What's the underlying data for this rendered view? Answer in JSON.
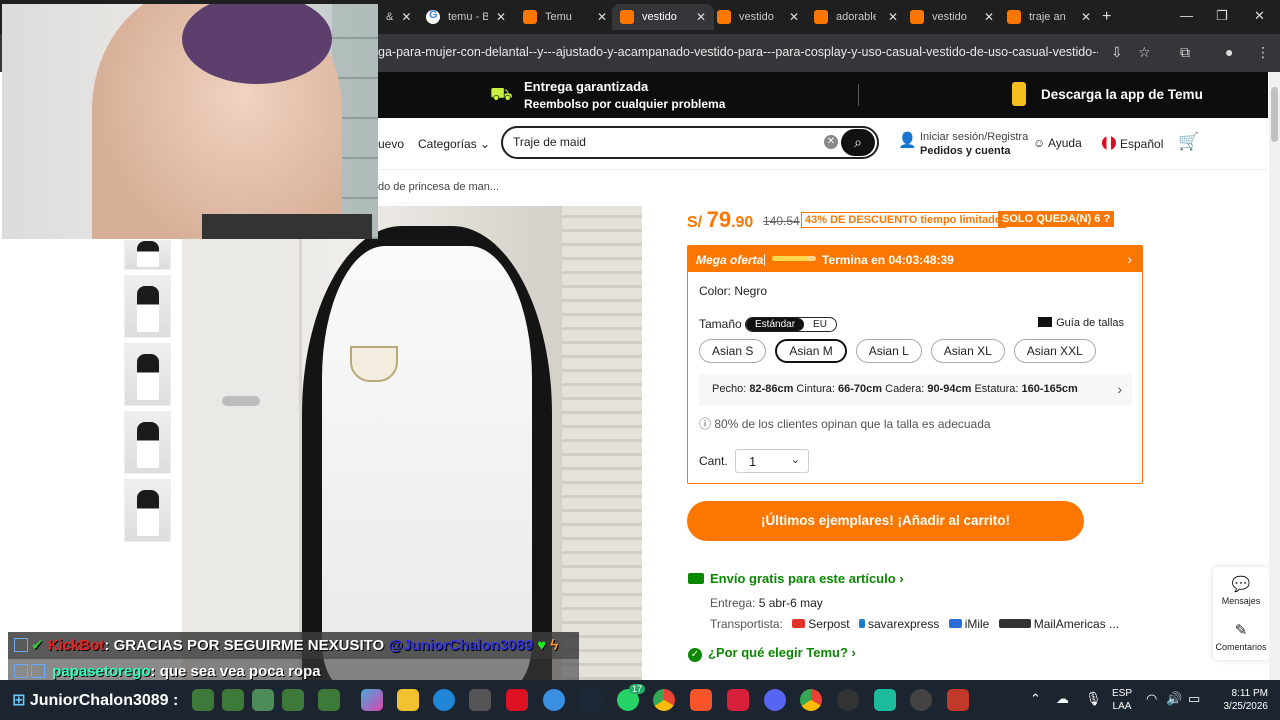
{
  "browser": {
    "tabs": [
      {
        "title": "&",
        "active": false,
        "favicon": "temu"
      },
      {
        "title": "temu - B",
        "active": false,
        "favicon": "google"
      },
      {
        "title": "Temu",
        "active": false,
        "favicon": "temu"
      },
      {
        "title": "vestido",
        "active": true,
        "favicon": "temu"
      },
      {
        "title": "vestido",
        "active": false,
        "favicon": "temu"
      },
      {
        "title": "adorable",
        "active": false,
        "favicon": "temu"
      },
      {
        "title": "vestido",
        "active": false,
        "favicon": "temu"
      },
      {
        "title": "traje an",
        "active": false,
        "favicon": "temu"
      }
    ],
    "url": "ga-para-mujer-con-delantal--y---ajustado-y-acampanado-vestido-para---para-cosplay-y-uso-casual-vestido-de-uso-casual-vestido--dobl..."
  },
  "banner": {
    "line1": "Entrega garantizada",
    "line2": "Reembolso por cualquier problema",
    "app": "Descarga la app de Temu"
  },
  "header": {
    "nuevo": "uevo",
    "categorias": "Categorías",
    "search_value": "Traje de maid",
    "login_line1": "Iniciar sesión/Registra",
    "login_line2": "Pedidos y cuenta",
    "help": "Ayuda",
    "language": "Español"
  },
  "breadcrumb": "do de princesa de man...",
  "product": {
    "currency": "S/",
    "price_int": "79",
    "price_dec": ".90",
    "old_price": "140.54",
    "discount": "43% DE DESCUENTO tiempo limitado",
    "stock": "SOLO QUEDA(N) 6",
    "offer_label": "Mega oferta",
    "offer_progress": 0.8,
    "offer_ends": "Termina en 04:03:48:39",
    "color_label": "Color: Negro",
    "size_label": "Tamaño",
    "size_modes": [
      "Estándar",
      "EU"
    ],
    "size_guide": "Guía de tallas",
    "sizes": [
      "Asian S",
      "Asian M",
      "Asian L",
      "Asian XL",
      "Asian XXL"
    ],
    "selected_size": "Asian M",
    "measure": {
      "pecho_label": "Pecho:",
      "pecho": "82-86cm",
      "cintura_label": "Cintura:",
      "cintura": "66-70cm",
      "cadera_label": "Cadera:",
      "cadera": "90-94cm",
      "estatura_label": "Estatura:",
      "estatura": "160-165cm"
    },
    "fit_note": "80% de los clientes opinan que la talla es adecuada",
    "qty_label": "Cant.",
    "qty_value": "1",
    "add_to_cart": "¡Últimos ejemplares! ¡Añadir al carrito!",
    "shipping": "Envío gratis para este artículo",
    "delivery_label": "Entrega:",
    "delivery": "5 abr-6 may",
    "carrier_label": "Transportista:",
    "carriers": [
      "Serpost",
      "savarexpress",
      "iMile",
      "MailAmericas ..."
    ],
    "why": "¿Por qué elegir Temu?"
  },
  "side_tools": {
    "messages": "Mensajes",
    "comments": "Comentarios"
  },
  "chat": {
    "line1_user": "KickBot",
    "line1_text": ": GRACIAS POR SEGUIRME NEXUSITO ",
    "line1_mention": "@JuniorChalon3089",
    "line2_user": "papasetorego",
    "line2_text": ": que sea vea poca ropa"
  },
  "taskbar": {
    "channel": "JuniorChalon3089 :",
    "lang1": "ESP",
    "lang2": "LAA",
    "time": "8:11 PM",
    "date": "3/25/2026",
    "badge_count": "17"
  },
  "colors": {
    "accent": "#fb7701",
    "green": "#0a8800"
  }
}
